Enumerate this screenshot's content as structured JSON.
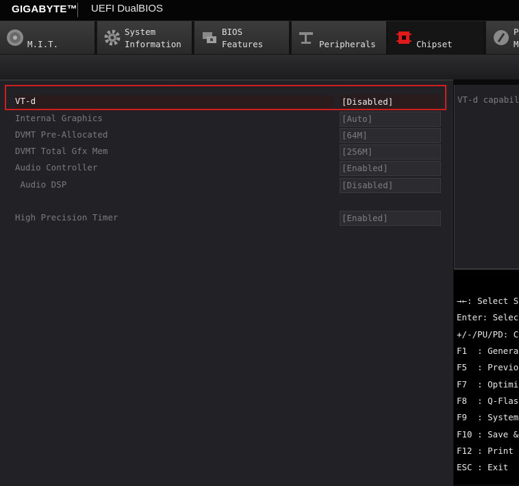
{
  "header": {
    "brand": "GIGABYTE™",
    "product": "UEFI DualBIOS"
  },
  "tabs": [
    {
      "line1": "",
      "line2": "M.I.T.",
      "icon": "dial-icon",
      "active": false
    },
    {
      "line1": "System",
      "line2": "Information",
      "icon": "gear-icon",
      "active": false
    },
    {
      "line1": "BIOS",
      "line2": "Features",
      "icon": "bios-chip-icon",
      "active": false
    },
    {
      "line1": "",
      "line2": "Peripherals",
      "icon": "peripherals-icon",
      "active": false
    },
    {
      "line1": "",
      "line2": "Chipset",
      "icon": "chipset-icon",
      "active": true
    },
    {
      "line1": "P",
      "line2": "M",
      "icon": "power-icon",
      "active": false
    }
  ],
  "settings": [
    {
      "label": "VT-d",
      "value": "[Disabled]",
      "selected": true
    },
    {
      "label": "Internal Graphics",
      "value": "[Auto]",
      "selected": false
    },
    {
      "label": "DVMT Pre-Allocated",
      "value": "[64M]",
      "selected": false
    },
    {
      "label": "DVMT Total Gfx Mem",
      "value": "[256M]",
      "selected": false
    },
    {
      "label": "Audio Controller",
      "value": "[Enabled]",
      "selected": false
    },
    {
      "label": " Audio DSP",
      "value": "[Disabled]",
      "selected": false
    },
    {
      "label": "High Precision Timer",
      "value": "[Enabled]",
      "selected": false
    }
  ],
  "help": {
    "text": "VT-d capabili"
  },
  "key_help": [
    "→←: Select S",
    "Enter: Selec",
    "+/-/PU/PD: C",
    "F1  : Genera",
    "F5  : Previo",
    "F7  : Optimi",
    "F8  : Q-Flas",
    "F9  : System",
    "F10 : Save &",
    "F12 : Print",
    "ESC : Exit"
  ],
  "colors": {
    "highlight_border": "#d11f1f",
    "chipset_icon": "#e01a1a"
  }
}
